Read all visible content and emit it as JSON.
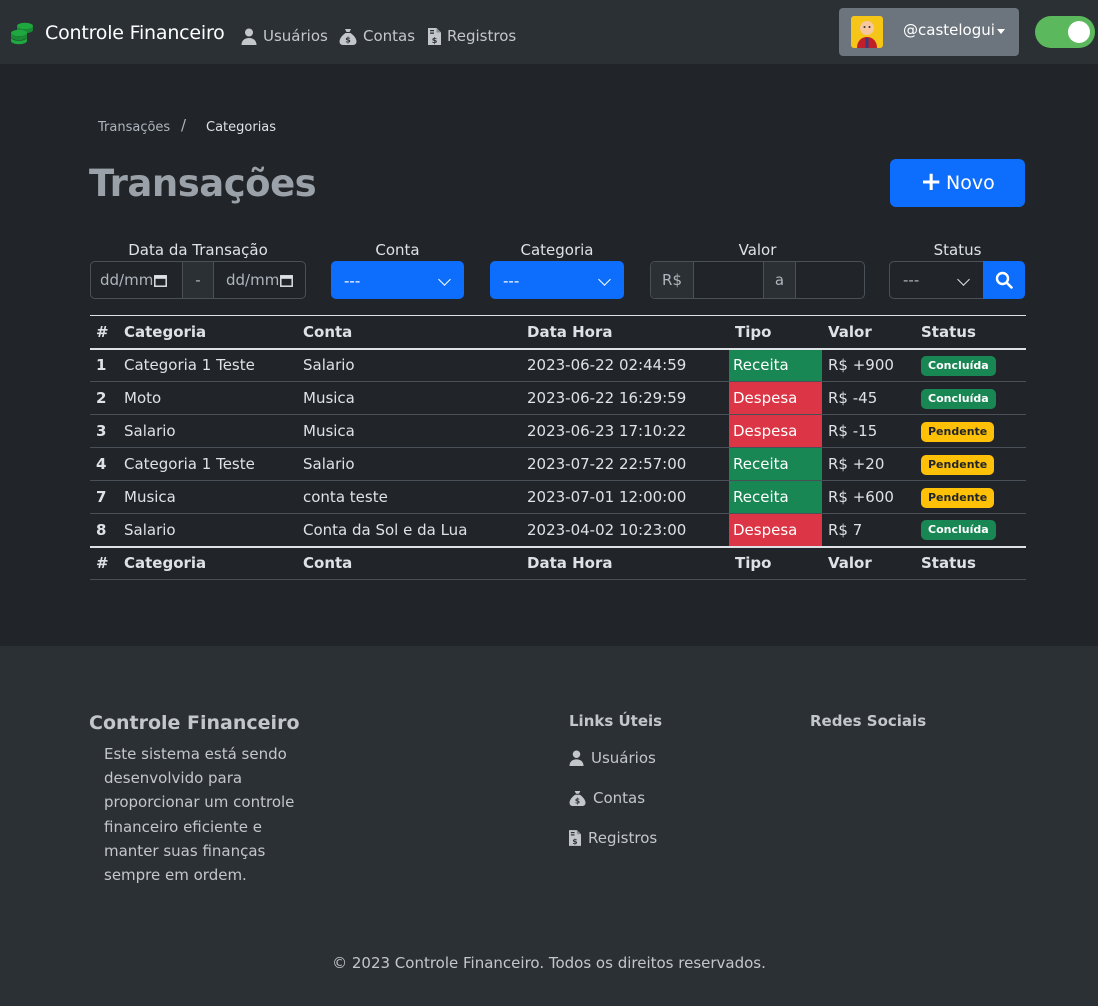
{
  "navbar": {
    "brand": "Controle Financeiro",
    "links": [
      {
        "label": "Usuários",
        "icon": "user-icon"
      },
      {
        "label": "Contas",
        "icon": "money-bag-icon"
      },
      {
        "label": "Registros",
        "icon": "file-invoice-dollar-icon"
      }
    ],
    "user": "@castelogui",
    "theme_toggle_on": true
  },
  "breadcrumb": [
    "Transações",
    "/",
    "Categorias"
  ],
  "page_title": "Transações",
  "new_button": {
    "icon": "+",
    "label": "Novo"
  },
  "filters": {
    "date_label": "Data da Transação",
    "date_from_placeholder": "dd/mm",
    "date_separator": "-",
    "date_to_placeholder": "dd/mm",
    "conta_label": "Conta",
    "conta_value": "---",
    "categoria_label": "Categoria",
    "categoria_value": "---",
    "valor_label": "Valor",
    "valor_prefix": "R$",
    "valor_separator": "a",
    "status_label": "Status",
    "status_value": "---"
  },
  "table": {
    "headers": [
      "#",
      "Categoria",
      "Conta",
      "Data Hora",
      "Tipo",
      "Valor",
      "Status"
    ],
    "rows": [
      {
        "id": "1",
        "categoria": "Categoria 1 Teste",
        "conta": "Salario",
        "data": "2023-06-22 02:44:59",
        "tipo": "Receita",
        "valor": "R$ +900",
        "status": "Concluída"
      },
      {
        "id": "2",
        "categoria": "Moto",
        "conta": "Musica",
        "data": "2023-06-22 16:29:59",
        "tipo": "Despesa",
        "valor": "R$ -45",
        "status": "Concluída"
      },
      {
        "id": "3",
        "categoria": "Salario",
        "conta": "Musica",
        "data": "2023-06-23 17:10:22",
        "tipo": "Despesa",
        "valor": "R$ -15",
        "status": "Pendente"
      },
      {
        "id": "4",
        "categoria": "Categoria 1 Teste",
        "conta": "Salario",
        "data": "2023-07-22 22:57:00",
        "tipo": "Receita",
        "valor": "R$ +20",
        "status": "Pendente"
      },
      {
        "id": "7",
        "categoria": "Musica",
        "conta": "conta teste",
        "data": "2023-07-01 12:00:00",
        "tipo": "Receita",
        "valor": "R$ +600",
        "status": "Pendente"
      },
      {
        "id": "8",
        "categoria": "Salario",
        "conta": "Conta da Sol e da Lua",
        "data": "2023-04-02 10:23:00",
        "tipo": "Despesa",
        "valor": "R$ 7",
        "status": "Concluída"
      }
    ]
  },
  "footer": {
    "title": "Controle Financeiro",
    "description": "Este sistema está sendo desenvolvido para proporcionar um controle financeiro eficiente e manter suas finanças sempre em ordem.",
    "links_heading": "Links Úteis",
    "links": [
      "Usuários",
      "Contas",
      "Registros"
    ],
    "social_heading": "Redes Sociais",
    "copyright": "© 2023 Controle Financeiro. Todos os direitos reservados."
  },
  "colors": {
    "background": "#212529",
    "navbar": "#2b3035",
    "primary": "#0d6efd",
    "receita": "#198754",
    "despesa": "#dc3545",
    "pendente": "#ffc107"
  }
}
